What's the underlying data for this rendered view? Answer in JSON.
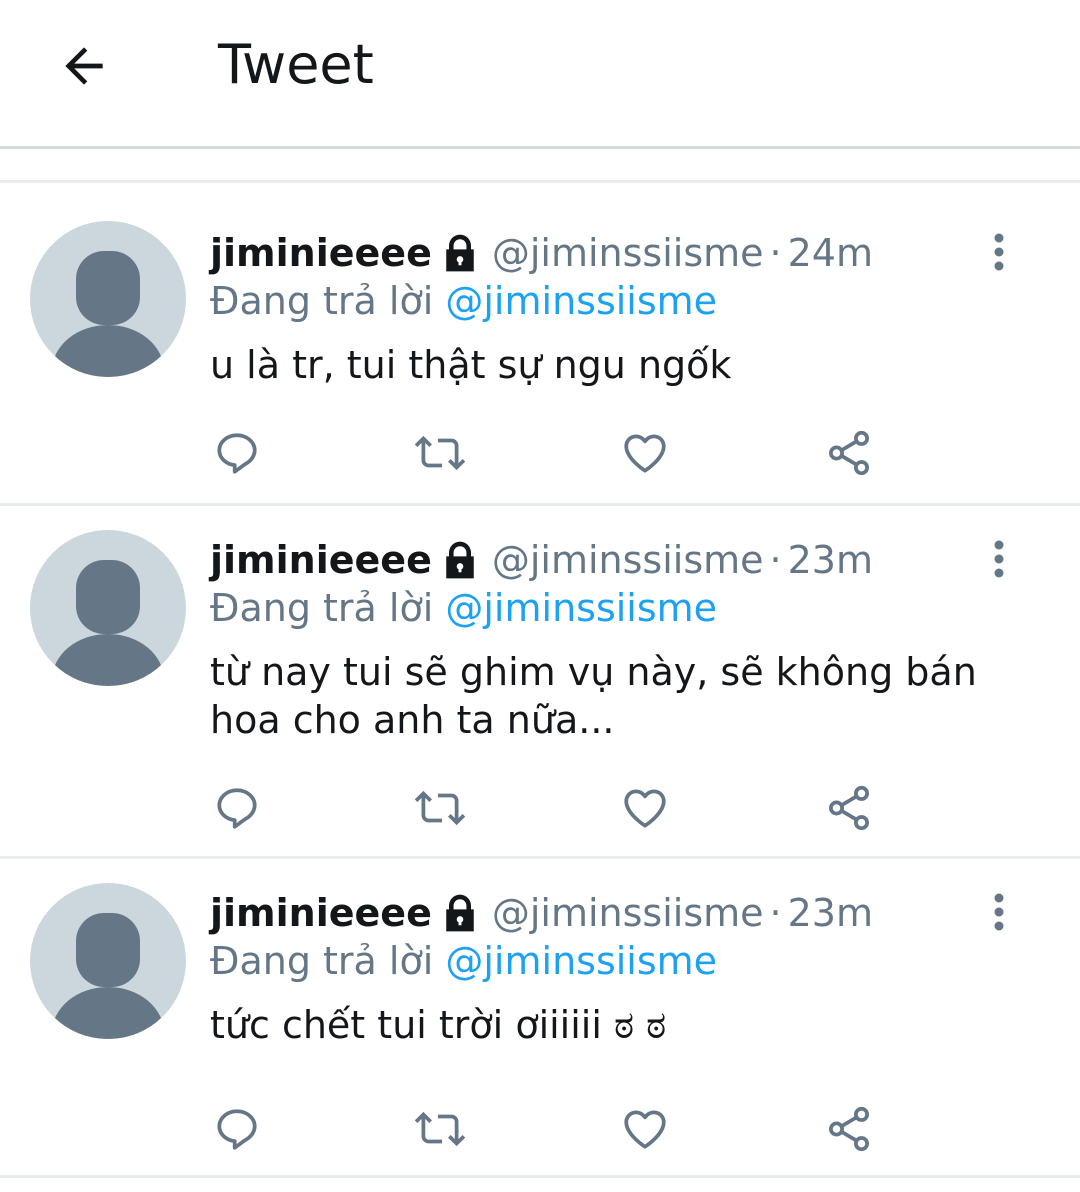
{
  "header": {
    "title": "Tweet",
    "back_icon": "arrow-left-icon"
  },
  "colors": {
    "text": "#14171a",
    "secondary": "#657786",
    "link": "#1da1f2",
    "avatar_bg": "#ccd6dd",
    "avatar_fg": "#657786",
    "divider": "#e6ecf0"
  },
  "tweets": [
    {
      "name": "jiminieeee",
      "handle": "@jiminssiisme",
      "separator": "·",
      "time": "24m",
      "reply_prefix": "Đang trả lời",
      "reply_handle": "@jiminssiisme",
      "text": "u là tr, tui thật sự ngu ngốk"
    },
    {
      "name": "jiminieeee",
      "handle": "@jiminssiisme",
      "separator": "·",
      "time": "23m",
      "reply_prefix": "Đang trả lời",
      "reply_handle": "@jiminssiisme",
      "text": "từ nay tui sẽ ghim vụ này, sẽ không bán hoa cho anh ta nữa..."
    },
    {
      "name": "jiminieeee",
      "handle": "@jiminssiisme",
      "separator": "·",
      "time": "23m",
      "reply_prefix": "Đang trả lời",
      "reply_handle": "@jiminssiisme",
      "text": "tức chết tui trời ơiiiiii ಠ ಠ"
    }
  ],
  "icons": {
    "lock": "lock-icon",
    "more": "more-vertical-icon",
    "reply": "reply-icon",
    "retweet": "retweet-icon",
    "like": "heart-icon",
    "share": "share-icon"
  }
}
